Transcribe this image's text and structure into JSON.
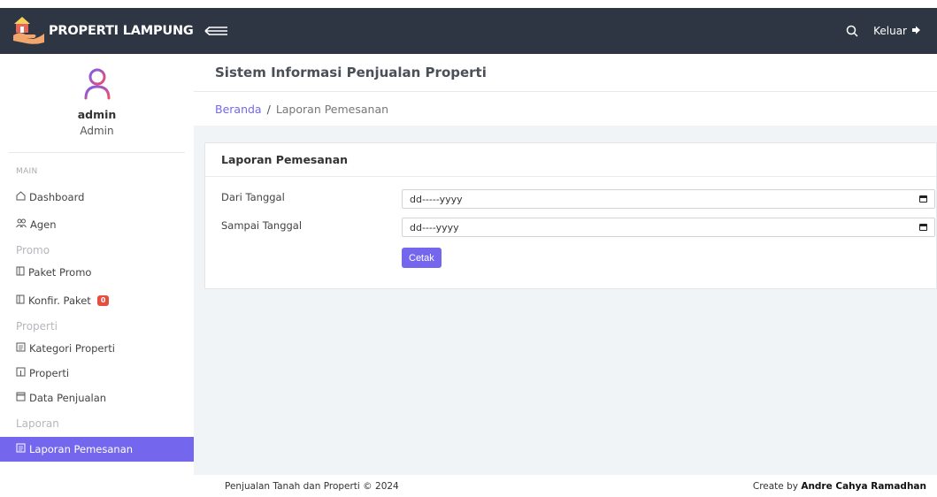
{
  "brand": {
    "title": "PROPERTI LAMPUNG"
  },
  "topbar": {
    "logout_label": "Keluar"
  },
  "user": {
    "name": "admin",
    "role": "Admin"
  },
  "sidebar": {
    "main_label": "MAIN",
    "items": [
      {
        "label": "Dashboard",
        "icon": "home-icon"
      },
      {
        "label": "Agen",
        "icon": "users-icon"
      }
    ],
    "promo_label": "Promo",
    "promo_items": [
      {
        "label": "Paket Promo",
        "icon": "door-icon"
      },
      {
        "label": "Konfir. Paket",
        "icon": "door-icon",
        "badge": "0"
      }
    ],
    "properti_label": "Properti",
    "properti_items": [
      {
        "label": "Kategori Properti",
        "icon": "list-icon"
      },
      {
        "label": "Properti",
        "icon": "door-icon"
      },
      {
        "label": "Data Penjualan",
        "icon": "table-icon"
      }
    ],
    "laporan_label": "Laporan",
    "laporan_items": [
      {
        "label": "Laporan Pemesanan",
        "icon": "list-icon",
        "active": true
      }
    ]
  },
  "page": {
    "header_title": "Sistem Informasi Penjualan Properti",
    "breadcrumb": {
      "home": "Beranda",
      "separator": "/",
      "current": "Laporan Pemesanan"
    }
  },
  "card": {
    "title": "Laporan Pemesanan",
    "fields": [
      {
        "label": "Dari Tanggal",
        "value": "dd-----yyyy"
      },
      {
        "label": "Sampai Tanggal",
        "value": "dd----yyyy"
      }
    ],
    "button_label": "Cetak"
  },
  "footer": {
    "left": "Penjualan Tanah dan Properti © 2024",
    "right_prefix": "Create by",
    "right_name": "Andre Cahya Ramadhan"
  },
  "colors": {
    "topbar": "#2e3643",
    "accent": "#7467ee",
    "badge": "#e84c3d",
    "content_bg": "#f0f4f7"
  }
}
